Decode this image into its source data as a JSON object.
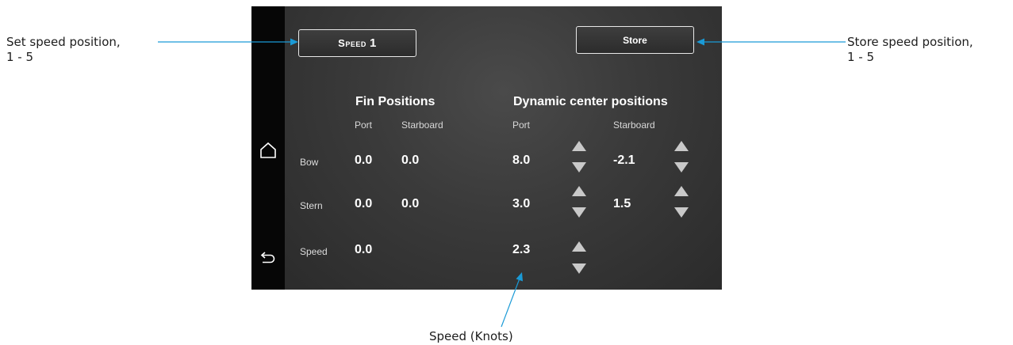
{
  "callouts": {
    "set_speed": {
      "line1": "Set speed position,",
      "line2": "1 - 5"
    },
    "store_speed": {
      "line1": "Store speed position,",
      "line2": "1 - 5"
    },
    "speed_knots": "Speed (Knots)"
  },
  "colors": {
    "callout_line": "#1a9ad6",
    "screen_bg": "#3a3a3a",
    "text": "#ffffff",
    "arrow": "#c9c9c9"
  },
  "nav": {
    "home_icon": "home-icon",
    "back_icon": "back-icon"
  },
  "header": {
    "speed_button": {
      "prefix": "Speed",
      "number": "1"
    },
    "store_label": "Store"
  },
  "fin_positions": {
    "title": "Fin Positions",
    "col_port": "Port",
    "col_starboard": "Starboard"
  },
  "dynamic": {
    "title": "Dynamic center positions",
    "col_port": "Port",
    "col_starboard": "Starboard"
  },
  "rows": {
    "bow": {
      "label": "Bow",
      "fin_port": "0.0",
      "fin_starboard": "0.0",
      "dyn_port": "8.0",
      "dyn_starboard": "-2.1"
    },
    "stern": {
      "label": "Stern",
      "fin_port": "0.0",
      "fin_starboard": "0.0",
      "dyn_port": "3.0",
      "dyn_starboard": "1.5"
    },
    "speed": {
      "label": "Speed",
      "fin_port": "0.0",
      "dyn_port": "2.3"
    }
  }
}
